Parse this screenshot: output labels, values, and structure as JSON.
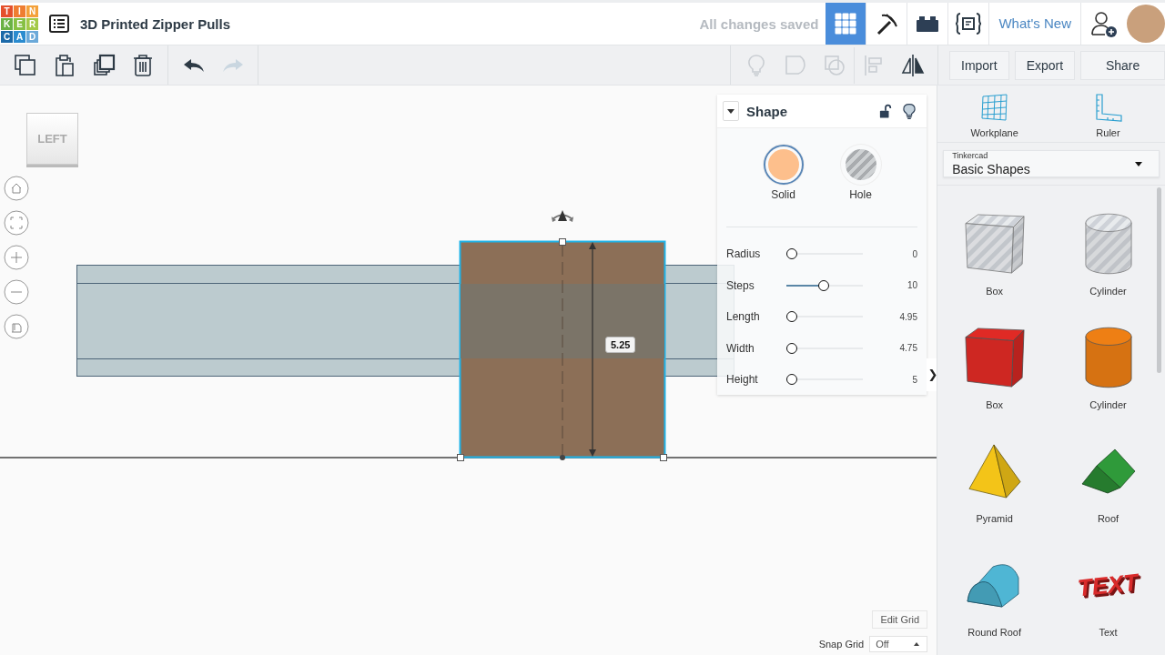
{
  "app": {
    "logo_letters": [
      {
        "letter": "T",
        "color": "#e4502c"
      },
      {
        "letter": "I",
        "color": "#ef7d31"
      },
      {
        "letter": "N",
        "color": "#f4a13a"
      },
      {
        "letter": "K",
        "color": "#6ab245"
      },
      {
        "letter": "E",
        "color": "#86c042"
      },
      {
        "letter": "R",
        "color": "#a3c948"
      },
      {
        "letter": "C",
        "color": "#1c6aa9"
      },
      {
        "letter": "A",
        "color": "#2a8bcf"
      },
      {
        "letter": "D",
        "color": "#6ba9d9"
      }
    ],
    "project_title": "3D Printed Zipper Pulls",
    "save_status": "All changes saved",
    "view_buttons": [
      {
        "kind": "grid",
        "selected": true
      },
      {
        "kind": "pickaxe",
        "selected": false
      },
      {
        "kind": "bricks",
        "selected": false
      },
      {
        "kind": "codeblocks",
        "selected": false
      }
    ],
    "whats_new": "What's New"
  },
  "toolbar": {
    "edit_tools": [
      {
        "kind": "copy",
        "disabled": false
      },
      {
        "kind": "paste",
        "disabled": false
      },
      {
        "kind": "duplicate",
        "disabled": false
      },
      {
        "kind": "delete",
        "disabled": false
      }
    ],
    "history": [
      {
        "kind": "undo",
        "disabled": false
      },
      {
        "kind": "redo",
        "disabled": true
      }
    ],
    "shape_tools": [
      {
        "kind": "lightbulb",
        "disabled": true
      },
      {
        "kind": "group",
        "disabled": true
      },
      {
        "kind": "ungroup",
        "disabled": true
      },
      {
        "kind": "align",
        "disabled": true
      },
      {
        "kind": "mirror",
        "disabled": false
      }
    ],
    "buttons": [
      "Import",
      "Export",
      "Share"
    ]
  },
  "view_cube": {
    "face": "LEFT"
  },
  "dimension": "5.25",
  "inspector": {
    "title": "Shape",
    "types": [
      {
        "label": "Solid",
        "kind": "solid",
        "selected": true
      },
      {
        "label": "Hole",
        "kind": "hole",
        "selected": false
      }
    ],
    "params": [
      {
        "name": "Radius",
        "level": 0,
        "value": "0"
      },
      {
        "name": "Steps",
        "level": 0.48,
        "value": "10"
      },
      {
        "name": "Length",
        "level": 0,
        "value": "4.95"
      },
      {
        "name": "Width",
        "level": 0,
        "value": "4.75"
      },
      {
        "name": "Height",
        "level": 0,
        "value": "5"
      }
    ]
  },
  "collapse_toggle": "❯",
  "grid": {
    "edit_button": "Edit Grid",
    "snap_label": "Snap Grid",
    "snap_value": "Off"
  },
  "library": {
    "tools": [
      {
        "kind": "workplane",
        "label": "Workplane"
      },
      {
        "kind": "ruler",
        "label": "Ruler"
      }
    ],
    "category_group": "Tinkercad",
    "category": "Basic Shapes",
    "shapes": [
      {
        "kind": "box",
        "label": "Box",
        "hole": true,
        "color": "#c3c8cf"
      },
      {
        "kind": "cylinder",
        "label": "Cylinder",
        "hole": true,
        "color": "#c3c8cf"
      },
      {
        "kind": "box",
        "label": "Box",
        "hole": false,
        "color": "#e02a25"
      },
      {
        "kind": "cylinder",
        "label": "Cylinder",
        "hole": false,
        "color": "#ee7f14"
      },
      {
        "kind": "pyramid",
        "label": "Pyramid",
        "hole": false,
        "color": "#f3c418"
      },
      {
        "kind": "roof",
        "label": "Roof",
        "hole": false,
        "color": "#2f9a3a"
      },
      {
        "kind": "round_roof",
        "label": "Round Roof",
        "hole": false,
        "color": "#4fb6d4"
      },
      {
        "kind": "text",
        "label": "Text",
        "hole": false,
        "color": "#d92b2b",
        "thumbnail_text": "TEXT"
      }
    ]
  }
}
